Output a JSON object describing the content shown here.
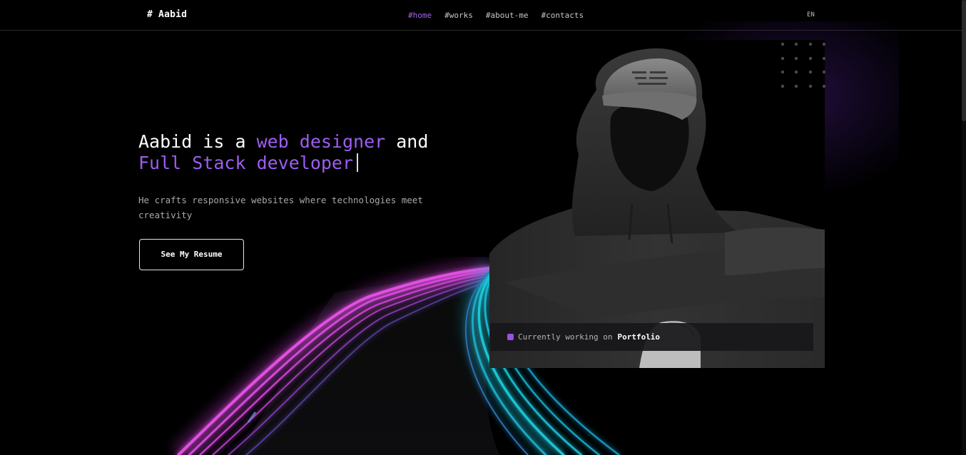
{
  "header": {
    "logo": "# Aabid",
    "nav": [
      {
        "label": "#home",
        "active": true
      },
      {
        "label": "#works",
        "active": false
      },
      {
        "label": "#about-me",
        "active": false
      },
      {
        "label": "#contacts",
        "active": false
      }
    ],
    "language": "EN"
  },
  "hero": {
    "headline": {
      "part1": "Aabid is a ",
      "highlight1": "web designer",
      "part2": " and",
      "highlight2": "Full Stack developer"
    },
    "subtitle": "He crafts responsive websites where technologies meet creativity",
    "resume_button": "See My Resume"
  },
  "status": {
    "text": "Currently working on",
    "project": "Portfolio"
  },
  "colors": {
    "accent": "#9c5ef0",
    "background": "#000000",
    "status_square": "#9c4fe0"
  },
  "icons": {
    "status": "square-bullet-icon",
    "decoration": "dot-grid-icon"
  }
}
